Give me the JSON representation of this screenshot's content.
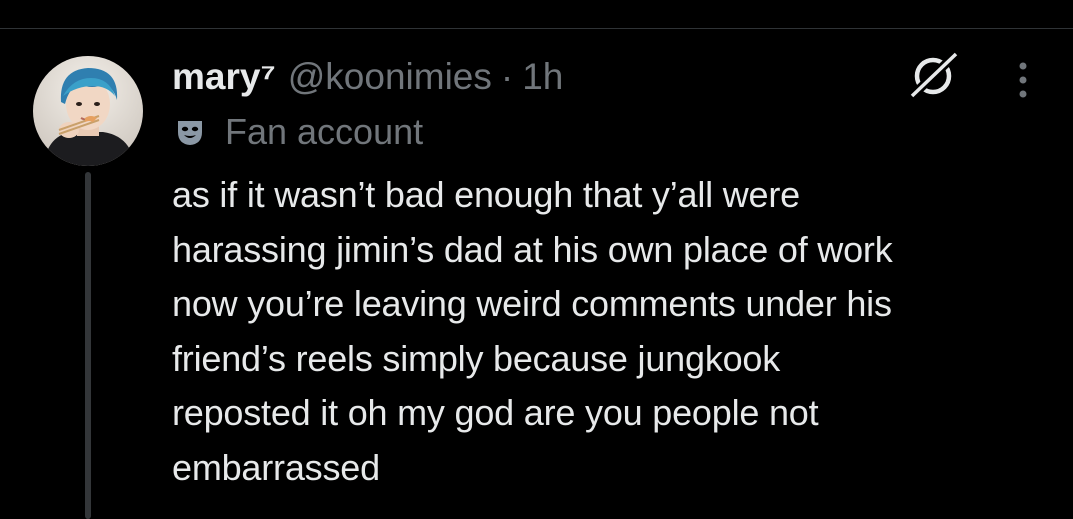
{
  "tweet": {
    "author": {
      "display_name": "mary⁷",
      "handle": "@koonimies",
      "separator": "·",
      "time": "1h",
      "avatar_icon": "user-avatar-photo"
    },
    "label": {
      "icon": "theater-mask-icon",
      "text": "Fan account"
    },
    "text_lines": [
      "as if it wasn’t bad enough that y’all were",
      "harassing jimin’s dad at his own place of work",
      "now you’re leaving weird comments under his",
      "friend’s reels simply because jungkook",
      "reposted it oh my god are you people not",
      "embarrassed"
    ],
    "actions": {
      "grok_icon": "grok-icon",
      "more_icon": "more-options-icon"
    }
  },
  "colors": {
    "background": "#000000",
    "primary_text": "#e7e9ea",
    "secondary_text": "#71767b",
    "thread_line": "#333639"
  }
}
